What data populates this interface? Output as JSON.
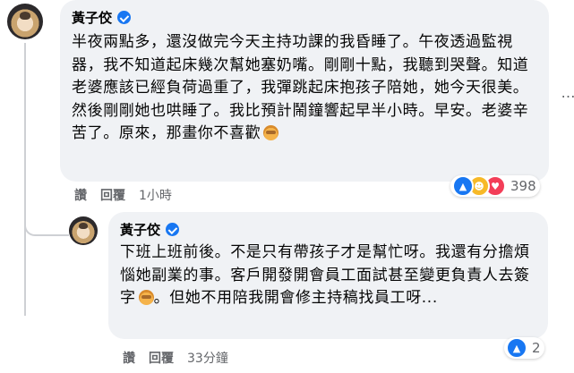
{
  "comment": {
    "author": "黃子佼",
    "text": "半夜兩點多，還沒做完今天主持功課的我昏睡了。午夜透過監視器，我不知道起床幾次幫她塞奶嘴。剛剛十點，我聽到哭聲。知道老婆應該已經負荷過重了，我彈跳起床抱孩子陪她，她今天很美。然後剛剛她也哄睡了。我比預計鬧鐘響起早半小時。早安。老婆辛苦了。原來，那畫你不喜歡",
    "emoji_icon": "see-no-evil-monkey-icon",
    "like_label": "讚",
    "reply_label": "回覆",
    "time": "1小時",
    "reaction_count": "398",
    "reaction_icons": [
      "like-icon",
      "haha-icon",
      "love-icon"
    ],
    "more_icon": "…"
  },
  "reply": {
    "author": "黃子佼",
    "text_part1": "下班上班前後。不是只有帶孩子才是幫忙呀。我還有分擔煩惱她副業的事。客戶開發開會員工面試甚至變更負責人去簽字",
    "text_part2": "。但她不用陪我開會修主持稿找員工呀...",
    "emoji_icon": "see-no-evil-monkey-icon",
    "like_label": "讚",
    "reply_label": "回覆",
    "time": "33分鐘",
    "reaction_count": "2",
    "reaction_icons": [
      "like-icon"
    ]
  },
  "colors": {
    "bubble_bg": "#f0f2f5",
    "secondary_text": "#65676b",
    "verified_blue": "#1877f2",
    "love_red": "#f33e58",
    "haha_yellow": "#f7b928"
  }
}
